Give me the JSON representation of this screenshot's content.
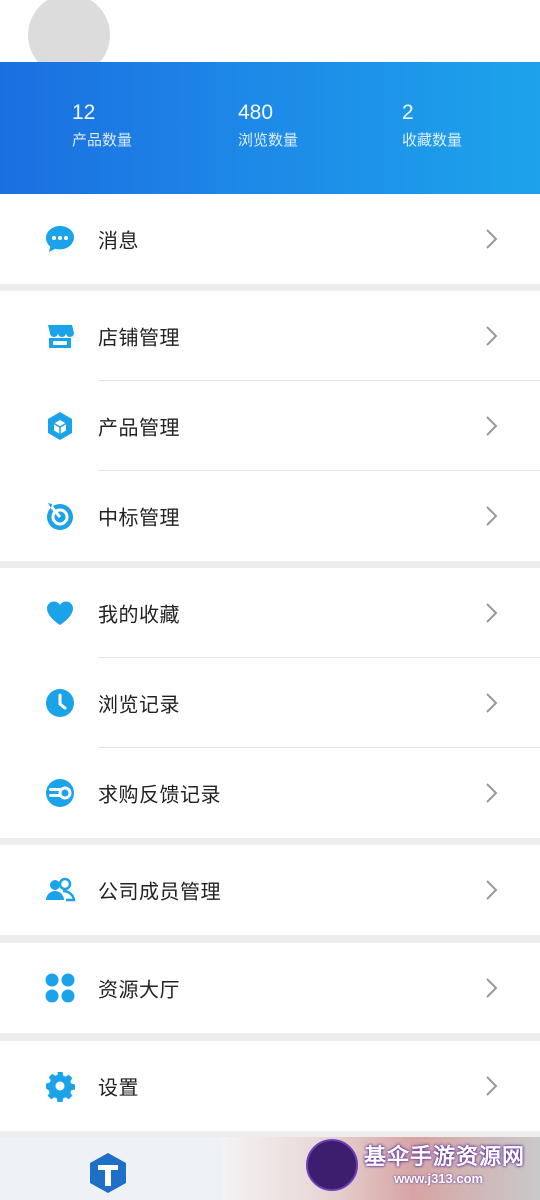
{
  "stats": [
    {
      "value": "12",
      "label": "产品数量"
    },
    {
      "value": "480",
      "label": "浏览数量"
    },
    {
      "value": "2",
      "label": "收藏数量"
    }
  ],
  "menu": {
    "messages": "消息",
    "shop": "店铺管理",
    "products": "产品管理",
    "bids": "中标管理",
    "favorites": "我的收藏",
    "history": "浏览记录",
    "feedback": "求购反馈记录",
    "members": "公司成员管理",
    "resources": "资源大厅",
    "settings": "设置"
  },
  "watermark": {
    "title": "基伞手游资源网",
    "url": "www.j313.com"
  },
  "colors": {
    "accent": "#1aa3e8",
    "header_start": "#1a6fe0",
    "header_end": "#1da3ea"
  },
  "icons": {
    "messages": "chat-bubble-icon",
    "shop": "storefront-icon",
    "products": "hexagon-cube-icon",
    "bids": "target-icon",
    "favorites": "heart-icon",
    "history": "clock-icon",
    "feedback": "feedback-icon",
    "members": "people-icon",
    "resources": "four-dots-icon",
    "settings": "gear-icon",
    "chevron": "chevron-right-icon"
  }
}
